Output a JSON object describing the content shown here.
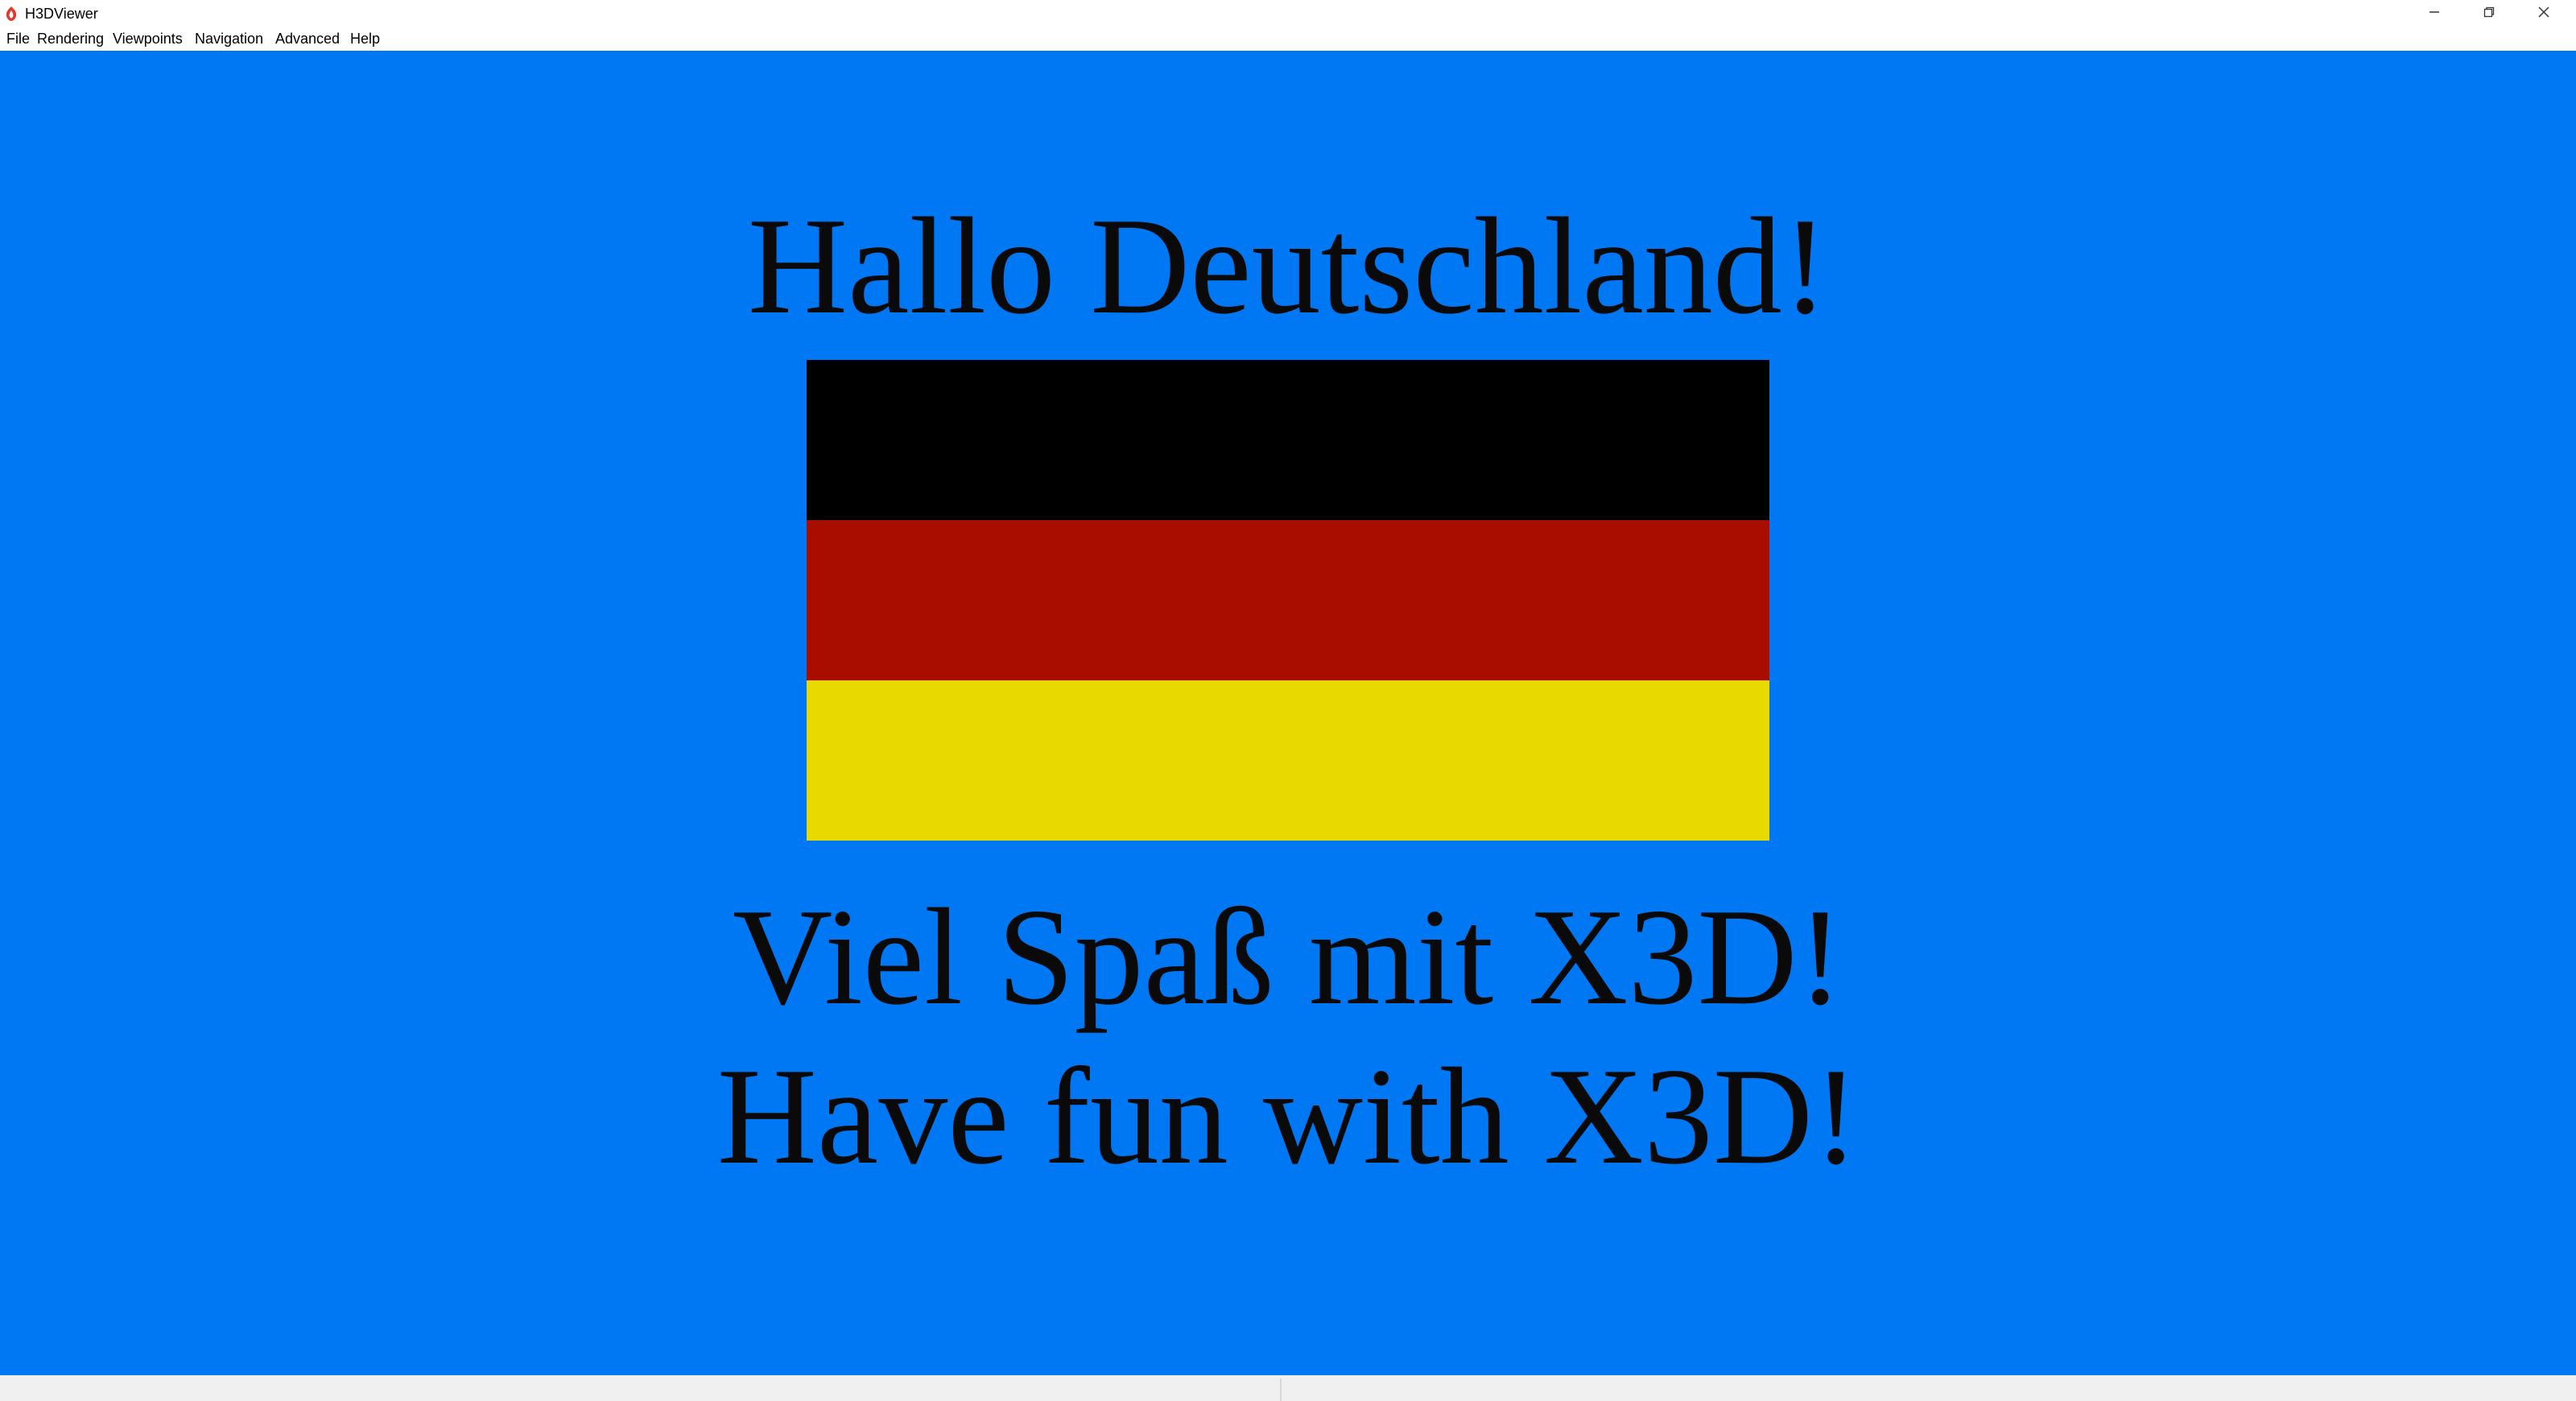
{
  "window": {
    "title": "H3DViewer"
  },
  "menu": {
    "items": [
      "File",
      "Rendering",
      "Viewpoints",
      "Navigation",
      "Advanced",
      "Help"
    ]
  },
  "scene": {
    "background_color": "#0077f3",
    "heading": "Hallo Deutschland!",
    "line_german": "Viel Spaß mit X3D!",
    "line_english": "Have fun with X3D!",
    "flag": {
      "stripes": [
        "#000000",
        "#a80d00",
        "#e8da00"
      ]
    }
  },
  "icons": {
    "app": "h3d-app-icon",
    "minimize": "minimize-icon",
    "restore": "restore-icon",
    "close": "close-icon"
  }
}
